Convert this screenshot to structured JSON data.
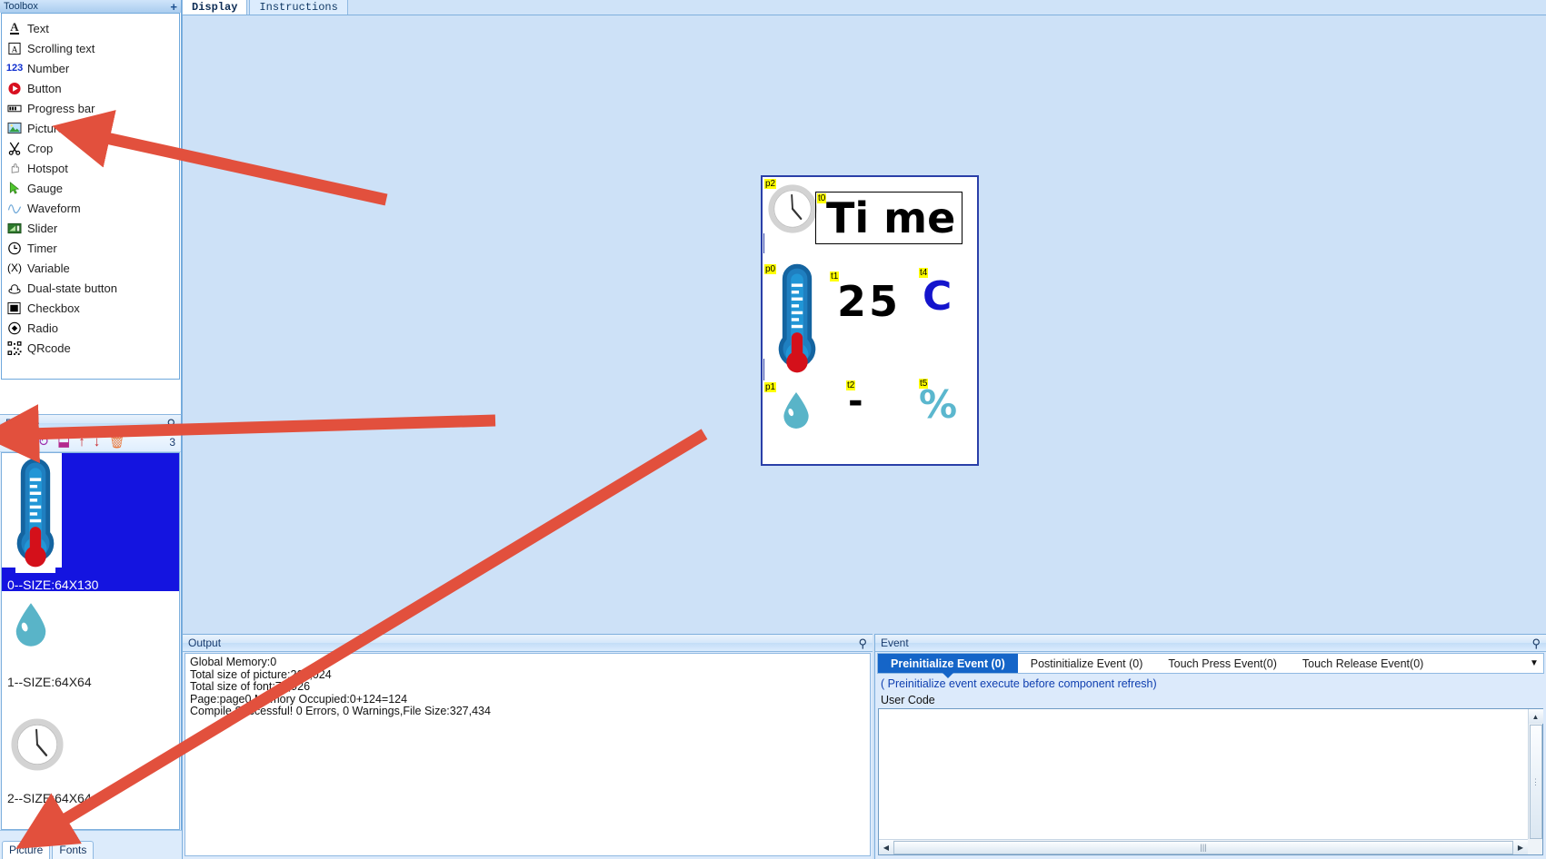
{
  "toolbox": {
    "title": "Toolbox",
    "add_label": "+",
    "items": [
      {
        "label": "Text",
        "icon": "text-icon"
      },
      {
        "label": "Scrolling text",
        "icon": "scrolling-text-icon"
      },
      {
        "label": "Number",
        "icon": "number-icon"
      },
      {
        "label": "Button",
        "icon": "button-icon"
      },
      {
        "label": "Progress bar",
        "icon": "progress-bar-icon"
      },
      {
        "label": "Picture",
        "icon": "picture-icon"
      },
      {
        "label": "Crop",
        "icon": "crop-icon"
      },
      {
        "label": "Hotspot",
        "icon": "hotspot-icon"
      },
      {
        "label": "Gauge",
        "icon": "gauge-icon"
      },
      {
        "label": "Waveform",
        "icon": "waveform-icon"
      },
      {
        "label": "Slider",
        "icon": "slider-icon"
      },
      {
        "label": "Timer",
        "icon": "timer-icon"
      },
      {
        "label": "Variable",
        "icon": "variable-icon"
      },
      {
        "label": "Dual-state button",
        "icon": "dual-state-button-icon"
      },
      {
        "label": "Checkbox",
        "icon": "checkbox-icon"
      },
      {
        "label": "Radio",
        "icon": "radio-icon"
      },
      {
        "label": "QRcode",
        "icon": "qrcode-icon"
      }
    ]
  },
  "picture_panel": {
    "title": "Picture",
    "pin_icon": "pin-icon",
    "count": "3",
    "toolbar": [
      {
        "name": "add-picture-button",
        "icon": "plus-icon",
        "glyph": "+",
        "color": "#c7242a"
      },
      {
        "name": "remove-picture-button",
        "icon": "minus-icon",
        "glyph": "−",
        "color": "#c7242a"
      },
      {
        "name": "refresh-picture-button",
        "icon": "refresh-icon",
        "glyph": "↻",
        "color": "#9b2fae"
      },
      {
        "name": "export-picture-button",
        "icon": "export-icon",
        "glyph": "⬓",
        "color": "#b32a8d"
      },
      {
        "name": "move-up-button",
        "icon": "arrow-up-icon",
        "glyph": "↑",
        "color": "#c7242a"
      },
      {
        "name": "move-down-button",
        "icon": "arrow-down-icon",
        "glyph": "↓",
        "color": "#c7242a"
      },
      {
        "name": "delete-picture-button",
        "icon": "trash-icon",
        "glyph": "🗑",
        "color": "#e8783c"
      }
    ],
    "items": [
      {
        "caption": "0--SIZE:64X130",
        "selected": true,
        "thumb": "thermometer"
      },
      {
        "caption": "1--SIZE:64X64",
        "selected": false,
        "thumb": "waterdrop"
      },
      {
        "caption": "2--SIZE:64X64",
        "selected": false,
        "thumb": "clock"
      }
    ],
    "tabs": [
      {
        "label": "Picture",
        "active": true
      },
      {
        "label": "Fonts",
        "active": false
      }
    ]
  },
  "top_tabs": [
    {
      "label": "Display",
      "active": true
    },
    {
      "label": "Instructions",
      "active": false
    }
  ],
  "canvas": {
    "background_color": "#cde1f7",
    "device_background": "#ffffff",
    "device_border_color": "#2a3fa8",
    "components": [
      {
        "id": "p2",
        "type": "picture",
        "content": "clock",
        "label": "p2"
      },
      {
        "id": "t0",
        "type": "text",
        "content": "Ti me",
        "label": "t0",
        "color": "#000000"
      },
      {
        "id": "p0",
        "type": "picture",
        "content": "thermometer",
        "label": "p0"
      },
      {
        "id": "t1",
        "type": "number",
        "content": "25",
        "label": "t1",
        "color": "#000000"
      },
      {
        "id": "t4",
        "type": "text",
        "content": "C",
        "label": "t4",
        "color": "#1414cc"
      },
      {
        "id": "p1",
        "type": "picture",
        "content": "waterdrop",
        "label": "p1"
      },
      {
        "id": "t2",
        "type": "number",
        "content": "-",
        "label": "t2",
        "color": "#000000"
      },
      {
        "id": "t5",
        "type": "text",
        "content": "%",
        "label": "t5",
        "color": "#5bb7ce"
      }
    ]
  },
  "output": {
    "title": "Output",
    "pin_icon": "pin-icon",
    "lines": [
      "Global Memory:0",
      "Total size of picture:265,024",
      "Total size of font:73,926",
      "Page:page0 Memory Occupied:0+124=124",
      "Compile Successful! 0 Errors, 0 Warnings,File Size:327,434"
    ]
  },
  "event": {
    "title": "Event",
    "pin_icon": "pin-icon",
    "tabs": [
      {
        "label": "Preinitialize Event (0)",
        "active": true
      },
      {
        "label": "Postinitialize Event (0)",
        "active": false
      },
      {
        "label": "Touch Press Event(0)",
        "active": false
      },
      {
        "label": "Touch Release Event(0)",
        "active": false
      }
    ],
    "more_icon": "chevron-down-icon",
    "note": "( Preinitialize event execute before component refresh)",
    "user_code_label": "User Code",
    "code_value": ""
  },
  "annotations": {
    "arrow_color": "#e2503d",
    "arrows": [
      {
        "name": "arrow-to-picture-tool"
      },
      {
        "name": "arrow-to-add-picture-button"
      },
      {
        "name": "arrow-to-picture-tab"
      }
    ]
  }
}
